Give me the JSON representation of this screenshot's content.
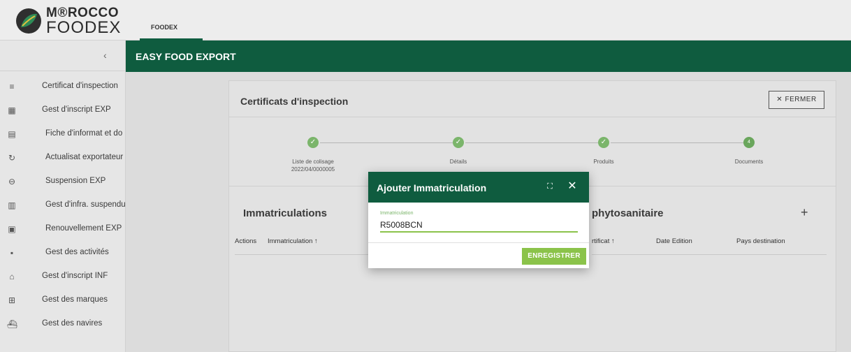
{
  "brand": {
    "line1": "M®ROCCO",
    "line2": "FOODEX",
    "colors": {
      "primary": "#0f5c3f",
      "accent": "#8bc34a",
      "step": "#7bb56b"
    }
  },
  "topbar": {
    "tab_label": "FOODEX"
  },
  "header": {
    "title": "EASY FOOD EXPORT"
  },
  "sidebar": {
    "collapse_icon": "chevron-left-icon",
    "items": [
      {
        "label": "Certificat d'inspection",
        "icon": "list-check-icon"
      },
      {
        "label": "Gest d'inscript EXP",
        "icon": "grid-icon"
      },
      {
        "label": "Fiche d'informat et do",
        "icon": "document-icon"
      },
      {
        "label": "Actualisat exportateur",
        "icon": "refresh-icon"
      },
      {
        "label": "Suspension EXP",
        "icon": "minus-circle-icon"
      },
      {
        "label": "Gest d'infra. suspendu",
        "icon": "building-icon"
      },
      {
        "label": "Renouvellement EXP",
        "icon": "id-card-icon"
      },
      {
        "label": "Gest des activités",
        "icon": "ticket-icon"
      },
      {
        "label": "Gest d'inscript INF",
        "icon": "bank-icon"
      },
      {
        "label": "Gest des marques",
        "icon": "plus-square-icon"
      },
      {
        "label": "Gest des navires",
        "icon": "ship-icon"
      }
    ]
  },
  "card": {
    "title": "Certificats d'inspection",
    "close_label": "FERMER",
    "steps": [
      {
        "label": "Liste de colisage",
        "sub": "2022/04/0000005",
        "state": "done"
      },
      {
        "label": "Détails",
        "sub": "",
        "state": "done"
      },
      {
        "label": "Produits",
        "sub": "",
        "state": "done"
      },
      {
        "label": "Documents",
        "sub": "",
        "state": "current",
        "number": "4"
      }
    ],
    "left_section": {
      "title": "Immatriculations",
      "columns": [
        "Actions",
        "Immatriculation ↑"
      ]
    },
    "right_section": {
      "title": "phytosanitaire",
      "columns": [
        "rtificat ↑",
        "Date Edition",
        "Pays destination"
      ]
    }
  },
  "dialog": {
    "title": "Ajouter Immatriculation",
    "field_label": "Immatriculation",
    "field_value": "R5008BCN",
    "save_label": "ENREGISTRER"
  }
}
